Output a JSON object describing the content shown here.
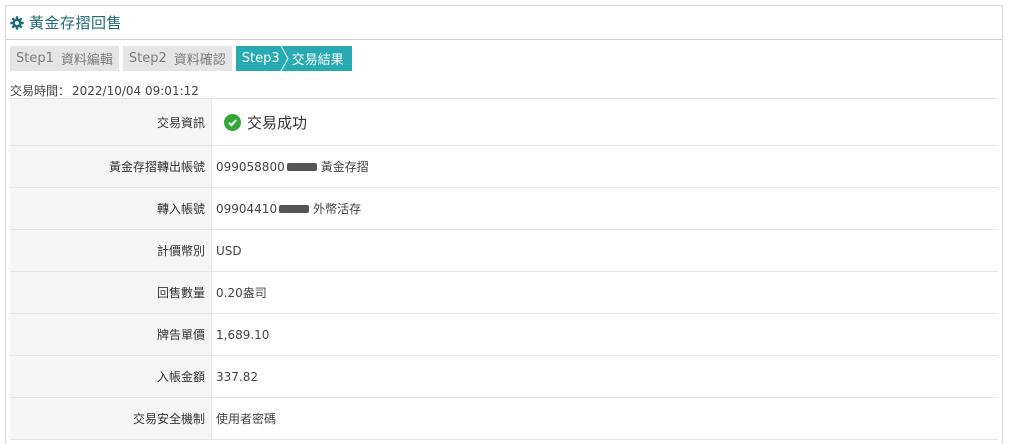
{
  "header": {
    "title": "黃金存摺回售"
  },
  "steps": [
    {
      "num": "Step1",
      "label": "資料編輯"
    },
    {
      "num": "Step2",
      "label": "資料確認"
    },
    {
      "num": "Step3",
      "label": "交易結果"
    }
  ],
  "transaction_time": {
    "label": "交易時間：",
    "value": "2022/10/04 09:01:12"
  },
  "rows": {
    "result": {
      "label": "交易資訊",
      "value": "交易成功"
    },
    "out_account": {
      "label": "黃金存摺轉出帳號",
      "account": "099058800",
      "suffix": "黃金存摺"
    },
    "in_account": {
      "label": "轉入帳號",
      "account": "09904410",
      "suffix": "外幣活存"
    },
    "currency": {
      "label": "計價幣別",
      "value": "USD"
    },
    "quantity": {
      "label": "回售數量",
      "value": "0.20盎司"
    },
    "unit_price": {
      "label": "牌告單價",
      "value": "1,689.10"
    },
    "amount": {
      "label": "入帳金額",
      "value": "337.82"
    },
    "security": {
      "label": "交易安全機制",
      "value": "使用者密碼"
    }
  },
  "colors": {
    "accent": "#27aab2",
    "title": "#1f6c76",
    "success": "#35a736"
  }
}
